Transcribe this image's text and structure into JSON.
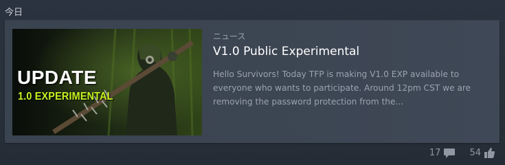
{
  "section": {
    "heading": "今日"
  },
  "news_item": {
    "type_label": "ニュース",
    "title": "V1.0 Public Experimental",
    "description": "Hello Survivors! Today TFP is making V1.0 EXP available to everyone who wants to participate. Around 12pm CST we are removing the password protection from the...",
    "thumbnail": {
      "headline": "UPDATE",
      "subline": "1.0 EXPERIMENTAL",
      "accent_color": "#c5f221"
    }
  },
  "stats": {
    "comments": "17",
    "likes": "54",
    "comment_icon": "comment-bubble-icon",
    "like_icon": "thumbs-up-icon"
  }
}
